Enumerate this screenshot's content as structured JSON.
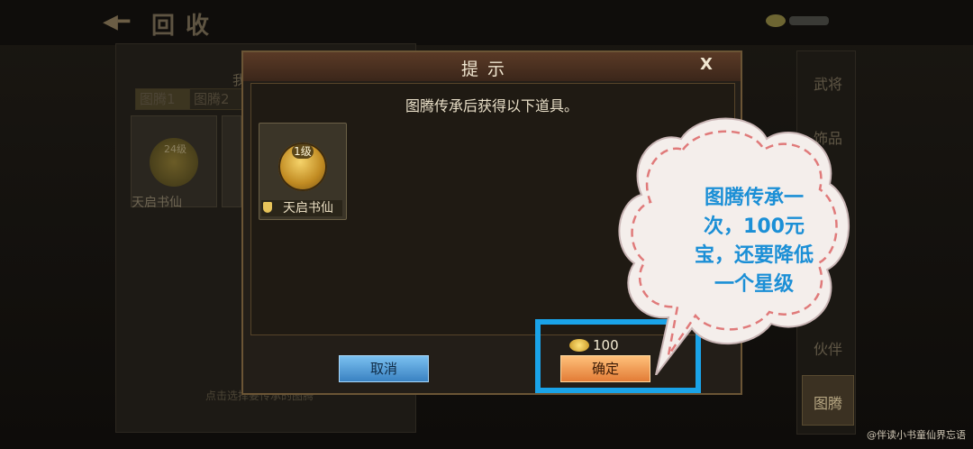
{
  "header": {
    "title": "回收"
  },
  "left_panel": {
    "partial_label": "我",
    "tabs": [
      "图腾1",
      "图腾2"
    ],
    "slot_level": "24级",
    "slot_name": "天启书仙",
    "hint": "点击选择要传承的图腾"
  },
  "side_tabs": [
    "武将",
    "饰品",
    "伙伴",
    "图腾"
  ],
  "dialog": {
    "title": "提示",
    "close_label": "X",
    "message": "图腾传承后获得以下道具。",
    "item": {
      "level": "1级",
      "name": "天启书仙"
    },
    "cancel_label": "取消",
    "cost": "100",
    "confirm_label": "确定"
  },
  "annotation": {
    "lines": [
      "图腾传承一",
      "次，100元",
      "宝，还要降低",
      "一个星级"
    ]
  },
  "watermark": "@伴读小书童仙界忘语",
  "colors": {
    "highlight": "#1aa3e8",
    "annotation_text": "#1b8fd6",
    "bubble_dash": "#e07a7a"
  }
}
